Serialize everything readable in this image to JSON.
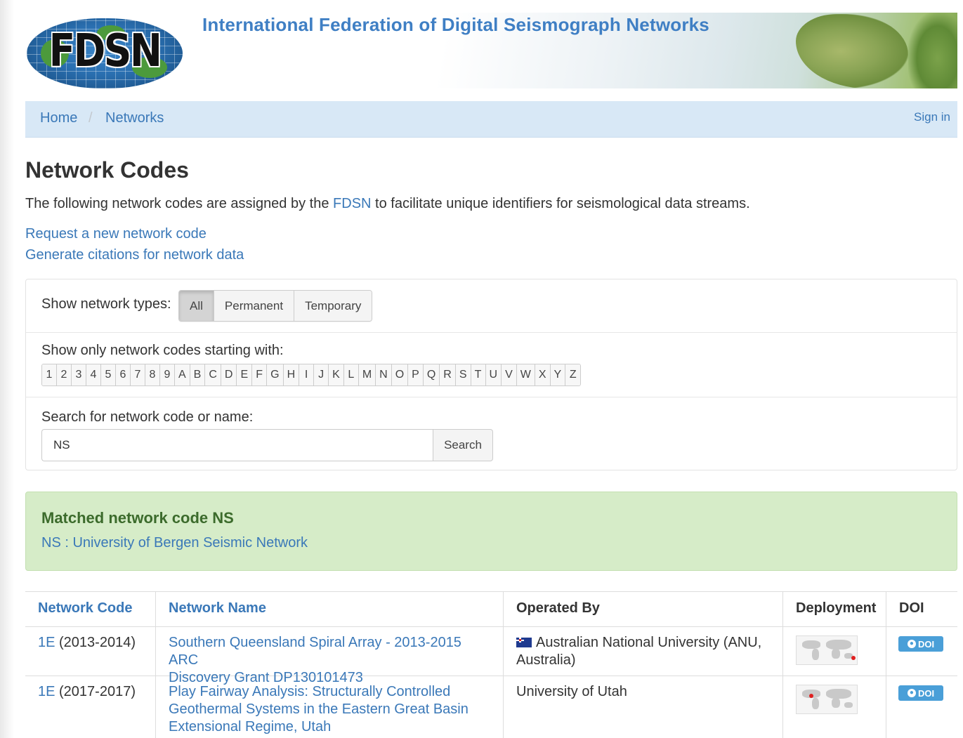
{
  "header": {
    "logo_text": "FDSN",
    "site_title": "International Federation of Digital Seismograph Networks"
  },
  "navbar": {
    "breadcrumbs": [
      "Home",
      "Networks"
    ],
    "sign_in": "Sign in"
  },
  "main": {
    "page_title": "Network Codes",
    "intro_before": "The following network codes are assigned by the ",
    "intro_link": "FDSN",
    "intro_after": " to facilitate unique identifiers for seismological data streams.",
    "request_link": "Request a new network code",
    "citations_link": "Generate citations for network data"
  },
  "filters": {
    "types_label": "Show network types:",
    "types": [
      "All",
      "Permanent",
      "Temporary"
    ],
    "active_type": "All",
    "starting_label": "Show only network codes starting with:",
    "letters": [
      "1",
      "2",
      "3",
      "4",
      "5",
      "6",
      "7",
      "8",
      "9",
      "A",
      "B",
      "C",
      "D",
      "E",
      "F",
      "G",
      "H",
      "I",
      "J",
      "K",
      "L",
      "M",
      "N",
      "O",
      "P",
      "Q",
      "R",
      "S",
      "T",
      "U",
      "V",
      "W",
      "X",
      "Y",
      "Z"
    ],
    "search_label": "Search for network code or name:",
    "search_value": "NS",
    "search_button": "Search"
  },
  "alert": {
    "title": "Matched network code NS",
    "link": "NS : University of Bergen Seismic Network"
  },
  "table": {
    "headers": {
      "code": "Network Code",
      "name": "Network Name",
      "operated_by": "Operated By",
      "deployment": "Deployment",
      "doi": "DOI"
    },
    "rows": [
      {
        "code": "1E",
        "years": " (2013-2014)",
        "name_line1": "Southern Queensland Spiral Array - 2013-2015 ARC",
        "name_line2": "Discovery Grant DP130101473",
        "name_line3": "",
        "operator_line1": "Australian National University (ANU,",
        "operator_line2": "Australia)",
        "has_flag": true,
        "doi_label": "DOI"
      },
      {
        "code": "1E",
        "years": " (2017-2017)",
        "name_line1": "Play Fairway Analysis: Structurally Controlled",
        "name_line2": "Geothermal Systems in the Eastern Great Basin",
        "name_line3": "Extensional Regime, Utah",
        "operator_line1": "University of Utah",
        "operator_line2": "",
        "has_flag": false,
        "doi_label": "DOI"
      }
    ]
  },
  "colors": {
    "link": "#3a78b8",
    "navbar_bg": "#d8e8f6",
    "alert_bg": "#d6ecc8",
    "alert_title": "#3c6b2c",
    "doi_button": "#4a9fd8"
  }
}
